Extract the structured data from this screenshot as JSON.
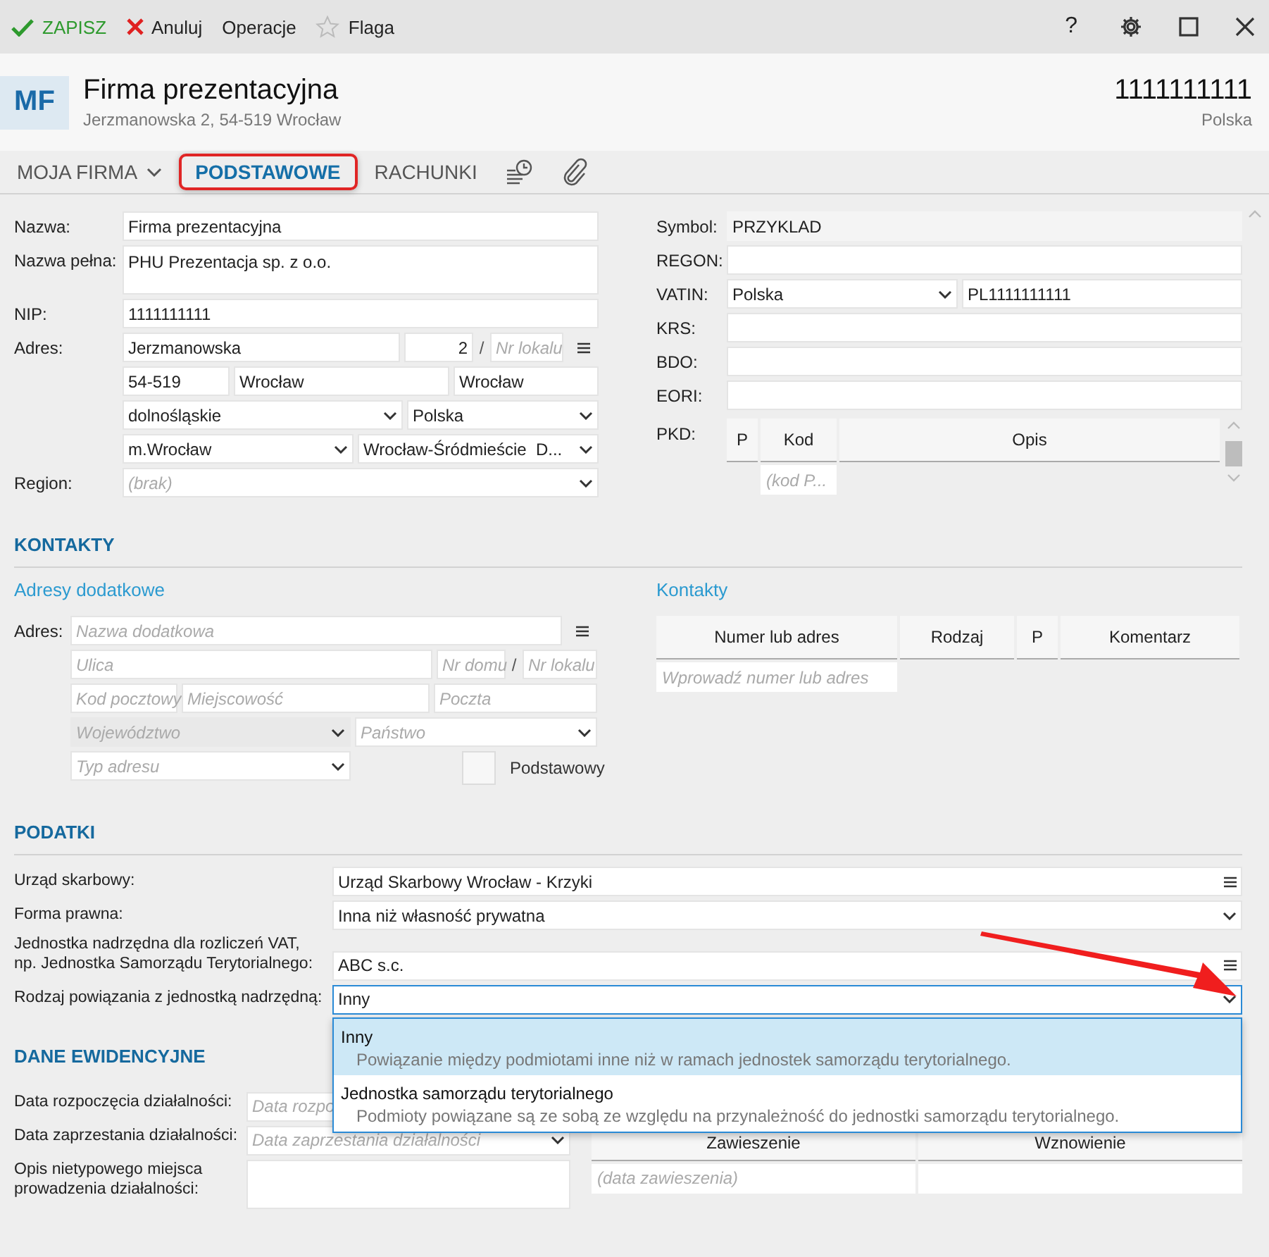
{
  "toolbar": [
    {
      "kind": "save",
      "label": "ZAPISZ"
    },
    {
      "kind": "cancel",
      "label": "Anuluj"
    },
    {
      "kind": "plain",
      "label": "Operacje"
    },
    {
      "kind": "flag",
      "label": "Flaga"
    }
  ],
  "help": "?",
  "header": {
    "initials": "MF",
    "name": "Firma prezentacyjna",
    "address": "Jerzmanowska 2, 54-519 Wrocław",
    "number": "1111111111",
    "country": "Polska"
  },
  "tabs": [
    {
      "kind": "menu",
      "label": "MOJA FIRMA",
      "selected": false,
      "highlighted": false
    },
    {
      "kind": "text",
      "label": "PODSTAWOWE",
      "selected": true,
      "highlighted": true
    },
    {
      "kind": "text",
      "label": "RACHUNKI",
      "selected": false,
      "highlighted": false
    },
    {
      "kind": "history",
      "selected": false,
      "highlighted": false
    },
    {
      "kind": "attachment",
      "selected": false,
      "highlighted": false
    }
  ],
  "basic_left": [
    {
      "label": "Nazwa:",
      "fields": [
        {
          "kind": "text",
          "value": "Firma prezentacyjna"
        }
      ]
    },
    {
      "label": "Nazwa pełna:",
      "fields": [
        {
          "kind": "textarea",
          "value": "PHU Prezentacja sp. z o.o."
        }
      ]
    },
    {
      "label": "NIP:",
      "fields": [
        {
          "kind": "text",
          "value": "1111111111"
        }
      ]
    },
    {
      "label": "Adres:",
      "menu": true,
      "fields": [
        {
          "kind": "text",
          "value": "Jerzmanowska"
        },
        {
          "kind": "number",
          "value": "2"
        },
        {
          "kind": "separator",
          "text": "/"
        },
        {
          "kind": "text",
          "placeholder": "Nr lokalu"
        }
      ]
    },
    {
      "fields": [
        {
          "kind": "text",
          "value": "54-519"
        },
        {
          "kind": "text",
          "value": "Wrocław"
        },
        {
          "kind": "text",
          "value": "Wrocław"
        }
      ]
    },
    {
      "fields": [
        {
          "kind": "select",
          "value": "dolnośląskie"
        },
        {
          "kind": "select",
          "value": "Polska"
        }
      ]
    },
    {
      "fields": [
        {
          "kind": "select",
          "value": "m.Wrocław"
        },
        {
          "kind": "select",
          "value": "Wrocław-Śródmieście  D..."
        }
      ]
    },
    {
      "label": "Region:",
      "fields": [
        {
          "kind": "select",
          "placeholder": "(brak)"
        }
      ]
    }
  ],
  "basic_right": [
    {
      "label": "Symbol:",
      "fields": [
        {
          "kind": "readonly",
          "value": "PRZYKLAD"
        }
      ]
    },
    {
      "label": "REGON:",
      "fields": [
        {
          "kind": "text"
        }
      ]
    },
    {
      "label": "VATIN:",
      "fields": [
        {
          "kind": "select",
          "value": "Polska"
        },
        {
          "kind": "text",
          "value": "PL1111111111"
        }
      ]
    },
    {
      "label": "KRS:",
      "fields": [
        {
          "kind": "text"
        }
      ]
    },
    {
      "label": "BDO:",
      "fields": [
        {
          "kind": "text"
        }
      ]
    },
    {
      "label": "EORI:",
      "fields": [
        {
          "kind": "text"
        }
      ]
    }
  ],
  "pkd": {
    "label": "PKD:",
    "columns": [
      "P",
      "Kod",
      "Opis"
    ],
    "placeholder": "(kod P..."
  },
  "contacts": {
    "title": "KONTAKTY",
    "addresses": {
      "title": "Adresy dodatkowe",
      "label": "Adres:",
      "rows": [
        {
          "menu": true,
          "fields": [
            {
              "kind": "text",
              "placeholder": "Nazwa dodatkowa"
            }
          ]
        },
        {
          "fields": [
            {
              "kind": "text",
              "placeholder": "Ulica"
            },
            {
              "kind": "text",
              "placeholder": "Nr domu"
            },
            {
              "kind": "separator",
              "text": "/"
            },
            {
              "kind": "text",
              "placeholder": "Nr lokalu"
            }
          ]
        },
        {
          "fields": [
            {
              "kind": "text",
              "placeholder": "Kod pocztowy"
            },
            {
              "kind": "text",
              "placeholder": "Miejscowość"
            },
            {
              "kind": "text",
              "placeholder": "Poczta"
            }
          ]
        },
        {
          "fields": [
            {
              "kind": "select",
              "placeholder": "Województwo",
              "disabled": true
            },
            {
              "kind": "select",
              "placeholder": "Państwo"
            }
          ]
        },
        {
          "fields": [
            {
              "kind": "select",
              "placeholder": "Typ adresu"
            },
            {
              "kind": "checkbox",
              "label": "Podstawowy",
              "checked": false
            }
          ]
        }
      ]
    },
    "list": {
      "title": "Kontakty",
      "columns": [
        "Numer lub adres",
        "Rodzaj",
        "P",
        "Komentarz"
      ],
      "placeholder": "Wprowadź numer lub adres"
    }
  },
  "taxes": {
    "title": "PODATKI",
    "rows": [
      {
        "label": "Urząd skarbowy:",
        "field": {
          "kind": "lookup",
          "value": "Urząd Skarbowy Wrocław - Krzyki"
        }
      },
      {
        "label": "Forma prawna:",
        "field": {
          "kind": "select",
          "value": "Inna niż własność prywatna"
        }
      },
      {
        "label": "Jednostka nadrzędna dla rozliczeń VAT,\nnp. Jednostka Samorządu Terytorialnego:",
        "field": {
          "kind": "lookup",
          "value": "ABC s.c."
        }
      },
      {
        "label": "Rodzaj powiązania z jednostką nadrzędną:",
        "field": {
          "kind": "select",
          "value": "Inny",
          "focused": true,
          "open": true,
          "options": [
            {
              "title": "Inny",
              "description": "Powiązanie między podmiotami inne niż w ramach jednostek samorządu terytorialnego.",
              "selected": true
            },
            {
              "title": "Jednostka samorządu terytorialnego",
              "description": "Podmioty powiązane są ze sobą ze względu na przynależność do jednostki samorządu terytorialnego.",
              "selected": false
            }
          ]
        }
      }
    ]
  },
  "records": {
    "title": "DANE EWIDENCYJNE",
    "rows": [
      {
        "label": "Data rozpoczęcia działalności:",
        "field": {
          "kind": "text",
          "placeholder": "Data rozpo"
        }
      },
      {
        "label": "Data zaprzestania działalności:",
        "field": {
          "kind": "select",
          "placeholder": "Data zaprzestania działalności"
        }
      },
      {
        "label": "Opis nietypowego miejsca\nprowadzenia działalności:",
        "field": {
          "kind": "textarea"
        }
      }
    ],
    "suspensions": {
      "columns": [
        "Zawieszenie",
        "Wznowienie"
      ],
      "placeholder": "(data zawieszenia)"
    }
  }
}
